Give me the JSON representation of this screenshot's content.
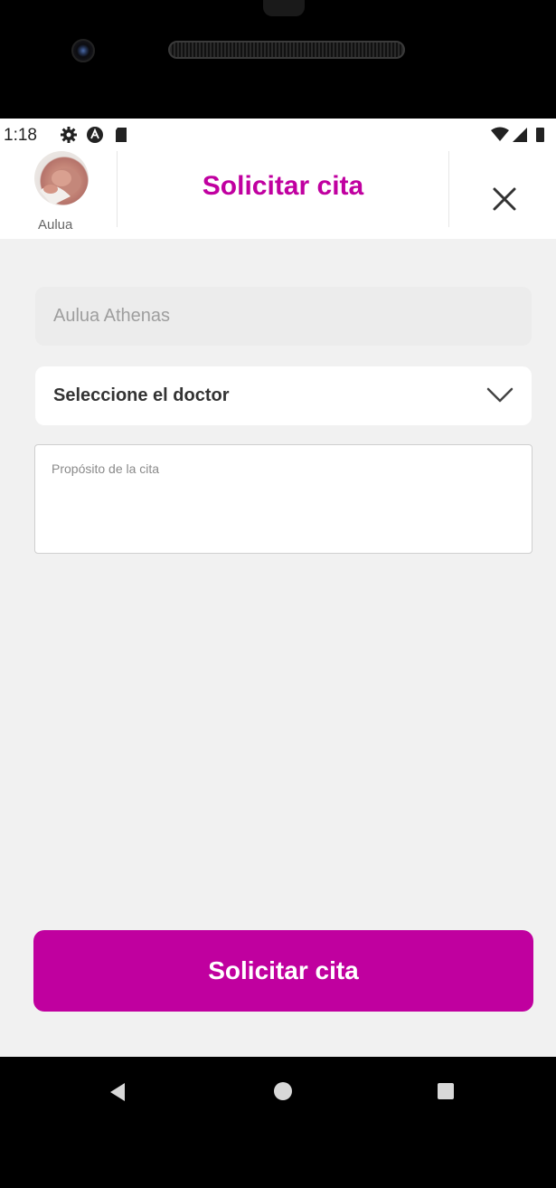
{
  "status_bar": {
    "time": "1:18",
    "left_icons": [
      "gear-icon",
      "notification-a-icon",
      "sd-card-icon"
    ],
    "right_icons": [
      "wifi-icon",
      "signal-icon",
      "battery-icon"
    ]
  },
  "header": {
    "profile_name": "Aulua",
    "title": "Solicitar cita",
    "close_icon": "close-icon"
  },
  "form": {
    "patient_name": "Aulua Athenas",
    "doctor_select_label": "Seleccione el doctor",
    "purpose_placeholder": "Propósito de la cita",
    "submit_label": "Solicitar cita"
  },
  "nav_bar": {
    "icons": [
      "back-icon",
      "home-icon",
      "recents-icon"
    ]
  },
  "colors": {
    "accent": "#c0009f",
    "background": "#f1f1f1"
  }
}
